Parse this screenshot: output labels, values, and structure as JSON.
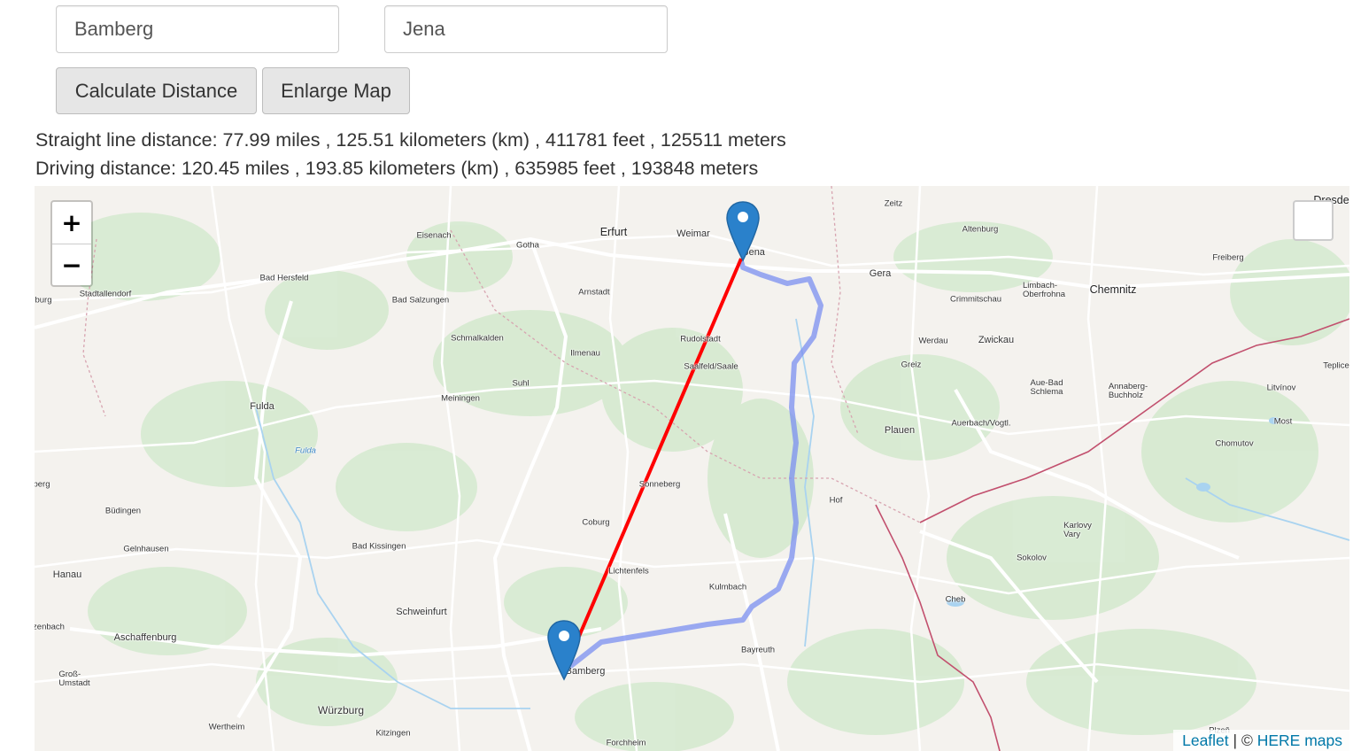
{
  "inputs": {
    "from_value": "Bamberg",
    "to_value": "Jena"
  },
  "buttons": {
    "calculate": "Calculate Distance",
    "enlarge": "Enlarge Map"
  },
  "results": {
    "straight": "Straight line distance: 77.99 miles , 125.51 kilometers (km) , 411781 feet , 125511 meters",
    "driving": "Driving distance: 120.45 miles , 193.85 kilometers (km) , 635985 feet , 193848 meters"
  },
  "map": {
    "zoom_in": "+",
    "zoom_out": "−",
    "attribution_leaflet": "Leaflet",
    "attribution_sep": "| ©",
    "attribution_here": "HERE maps",
    "colors": {
      "straight_line": "#ff0000",
      "route": "#7b8ff0",
      "marker": "#2a81cb"
    },
    "labels": {
      "dresden": "Dresden",
      "zeitz": "Zeitz",
      "erfurt": "Erfurt",
      "weimar": "Weimar",
      "jena": "Jena",
      "eisenach": "Eisenach",
      "gotha": "Gotha",
      "altenburg": "Altenburg",
      "bad_hersfeld": "Bad Hersfeld",
      "stadtallendorf": "Stadtallendorf",
      "burg": "burg",
      "gera": "Gera",
      "freiberg": "Freiberg",
      "chemnitz": "Chemnitz",
      "bad_salzungen": "Bad Salzungen",
      "arnstadt": "Arnstadt",
      "crimmitschau": "Crimmitschau",
      "limbach": "Limbach-\nOberfrohna",
      "schmalkalden": "Schmalkalden",
      "rudolstadt": "Rudolstadt",
      "werdau": "Werdau",
      "zwickau": "Zwickau",
      "ilmenau": "Ilmenau",
      "saalfeld": "Saalfeld/Saale",
      "greiz": "Greiz",
      "teplice": "Teplice",
      "suhl": "Suhl",
      "aue": "Aue-Bad\nSchlema",
      "annaberg": "Annaberg-\nBuchholz",
      "litvinov": "Litvínov",
      "fulda": "Fulda",
      "meiningen": "Meiningen",
      "auerbach": "Auerbach/Vogtl.",
      "most": "Most",
      "plauen": "Plauen",
      "fulda_river": "Fulda",
      "chomutov": "Chomutov",
      "sonneberg": "Sonneberg",
      "berg": "berg",
      "hof": "Hof",
      "budingen": "Büdingen",
      "coburg": "Coburg",
      "karlovy": "Karlovy\nVary",
      "gelnhausen": "Gelnhausen",
      "bad_kissingen": "Bad Kissingen",
      "sokolov": "Sokolov",
      "hanau": "Hanau",
      "lichtenfels": "Lichtenfels",
      "kulmbach": "Kulmbach",
      "cheb": "Cheb",
      "schweinfurt": "Schweinfurt",
      "aschaffenburg": "Aschaffenburg",
      "bayreuth": "Bayreuth",
      "zenbach": "zenbach",
      "bamberg": "Bamberg",
      "gross_umstadt": "Groß-\nUmstadt",
      "wurzburg": "Würzburg",
      "wertheim": "Wertheim",
      "kitzingen": "Kitzingen",
      "forchheim": "Forchheim",
      "plzen": "Plzeň"
    }
  }
}
